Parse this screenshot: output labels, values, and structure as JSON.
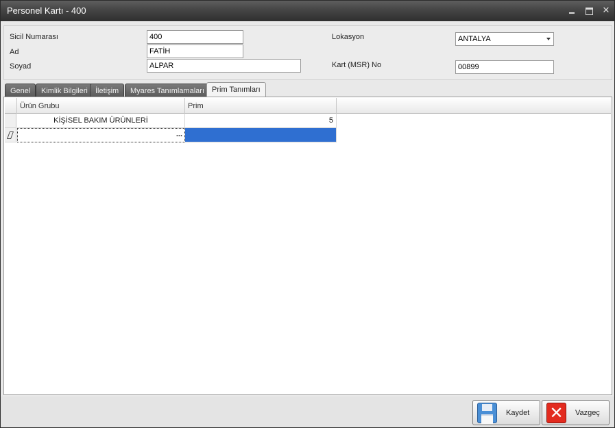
{
  "window": {
    "title": "Personel Kartı - 400",
    "controls": {
      "minimize": "minimize-icon",
      "maximize": "maximize-icon",
      "close": "✕"
    }
  },
  "form": {
    "sicil_label": "Sicil Numarası",
    "sicil_value": "400",
    "ad_label": "Ad",
    "ad_value": "FATİH",
    "soyad_label": "Soyad",
    "soyad_value": "ALPAR",
    "lokasyon_label": "Lokasyon",
    "lokasyon_value": "ANTALYA",
    "kart_label": "Kart (MSR) No",
    "kart_value": "00899"
  },
  "tabs": [
    {
      "label": "Genel"
    },
    {
      "label": "Kimlik Bilgileri"
    },
    {
      "label": "İletişim"
    },
    {
      "label": "Myares Tanımlamaları"
    },
    {
      "label": "Prim Tanımları"
    }
  ],
  "active_tab": "Prim Tanımları",
  "grid": {
    "columns": [
      "Ürün Grubu",
      "Prim"
    ],
    "rows": [
      {
        "urun_grubu": "KİŞİSEL BAKIM ÜRÜNLERİ",
        "prim": "5"
      }
    ],
    "new_row_ellipsis": "..."
  },
  "footer": {
    "save_label": "Kaydet",
    "cancel_label": "Vazgeç"
  },
  "colors": {
    "selection": "#2f6fd1",
    "titlebar": "#3a3a3a",
    "cancel_icon": "#e32b1f",
    "save_icon": "#4a8fd6"
  }
}
